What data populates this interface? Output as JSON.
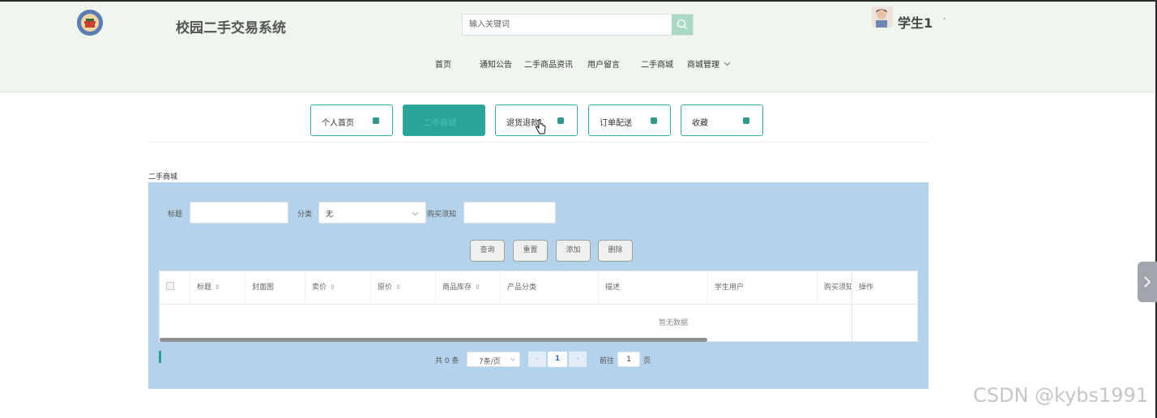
{
  "header": {
    "site_title": "校园二手交易系统",
    "search_placeholder": "输入关键词",
    "user_name": "学生1",
    "user_caret": "-",
    "nav": [
      "首页",
      "通知公告",
      "二手商品资讯",
      "用户留言",
      "二手商城",
      "商城管理"
    ]
  },
  "tabs": [
    {
      "label": "个人首页",
      "active": false
    },
    {
      "label": "二手商城",
      "active": true
    },
    {
      "label": "退货退款",
      "active": false
    },
    {
      "label": "订单配送",
      "active": false
    },
    {
      "label": "收藏",
      "active": false
    }
  ],
  "section_title": "二手商城",
  "filters": {
    "title_label": "标题",
    "category_label": "分类",
    "category_value": "无",
    "notice_label": "购买须知"
  },
  "buttons": {
    "query": "查询",
    "reset": "重置",
    "add": "添加",
    "delete": "删除"
  },
  "table": {
    "columns": [
      "标题",
      "封面图",
      "卖价",
      "原价",
      "商品库存",
      "产品分类",
      "描述",
      "学生用户",
      "购买须知",
      "操作"
    ],
    "empty_text": "暂无数据"
  },
  "pagination": {
    "total": "共 0 条",
    "page_size": "7条/页",
    "current_page": "1",
    "goto_label": "前往",
    "goto_value": "1",
    "page_suffix": "页"
  },
  "watermark": "CSDN @kybs1991",
  "colors": {
    "accent": "#29a597",
    "panel": "#b4d3ea",
    "header_bg": "#eef6ee"
  }
}
